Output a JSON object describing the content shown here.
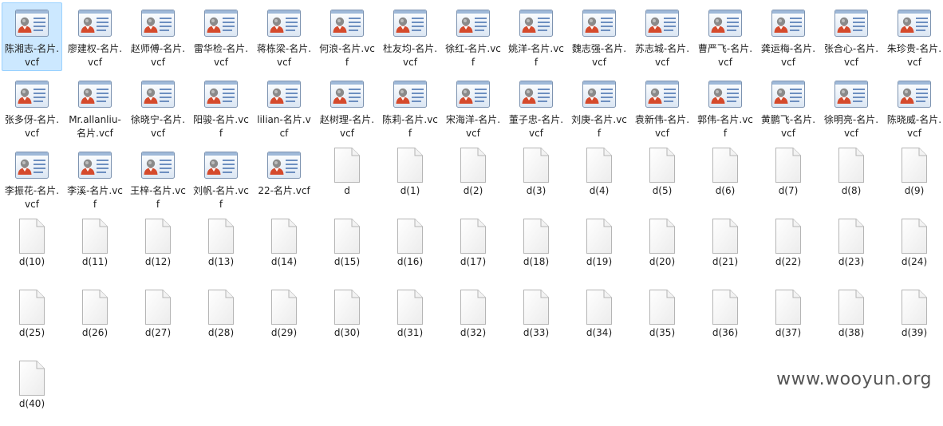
{
  "files": [
    {
      "name": "陈湘志-名片.vcf",
      "type": "vcf",
      "selected": true
    },
    {
      "name": "廖建权-名片.vcf",
      "type": "vcf"
    },
    {
      "name": "赵师傅-名片.vcf",
      "type": "vcf"
    },
    {
      "name": "雷华检-名片.vcf",
      "type": "vcf"
    },
    {
      "name": "蒋栋梁-名片.vcf",
      "type": "vcf"
    },
    {
      "name": "何浪-名片.vcf",
      "type": "vcf"
    },
    {
      "name": "杜友均-名片.vcf",
      "type": "vcf"
    },
    {
      "name": "徐红-名片.vcf",
      "type": "vcf"
    },
    {
      "name": "姚洋-名片.vcf",
      "type": "vcf"
    },
    {
      "name": "魏志强-名片.vcf",
      "type": "vcf"
    },
    {
      "name": "苏志城-名片.vcf",
      "type": "vcf"
    },
    {
      "name": "曹严飞-名片.vcf",
      "type": "vcf"
    },
    {
      "name": "龚运梅-名片.vcf",
      "type": "vcf"
    },
    {
      "name": "张合心-名片.vcf",
      "type": "vcf"
    },
    {
      "name": "朱珍贵-名片.vcf",
      "type": "vcf"
    },
    {
      "name": "张多伢-名片.vcf",
      "type": "vcf"
    },
    {
      "name": "Mr.allanliu-名片.vcf",
      "type": "vcf"
    },
    {
      "name": "徐晓宁-名片.vcf",
      "type": "vcf"
    },
    {
      "name": "阳骏-名片.vcf",
      "type": "vcf"
    },
    {
      "name": "lilian-名片.vcf",
      "type": "vcf"
    },
    {
      "name": "赵树理-名片.vcf",
      "type": "vcf"
    },
    {
      "name": "陈莉-名片.vcf",
      "type": "vcf"
    },
    {
      "name": "宋海洋-名片.vcf",
      "type": "vcf"
    },
    {
      "name": "董子忠-名片.vcf",
      "type": "vcf"
    },
    {
      "name": "刘庚-名片.vcf",
      "type": "vcf"
    },
    {
      "name": "袁新伟-名片.vcf",
      "type": "vcf"
    },
    {
      "name": "郭伟-名片.vcf",
      "type": "vcf"
    },
    {
      "name": "黄鹏飞-名片.vcf",
      "type": "vcf"
    },
    {
      "name": "徐明亮-名片.vcf",
      "type": "vcf"
    },
    {
      "name": "陈晓威-名片.vcf",
      "type": "vcf"
    },
    {
      "name": "李振花-名片.vcf",
      "type": "vcf"
    },
    {
      "name": "李溪-名片.vcf",
      "type": "vcf"
    },
    {
      "name": "王梓-名片.vcf",
      "type": "vcf"
    },
    {
      "name": "刘帆-名片.vcf",
      "type": "vcf"
    },
    {
      "name": "22-名片.vcf",
      "type": "vcf"
    },
    {
      "name": "d",
      "type": "blank"
    },
    {
      "name": "d(1)",
      "type": "blank"
    },
    {
      "name": "d(2)",
      "type": "blank"
    },
    {
      "name": "d(3)",
      "type": "blank"
    },
    {
      "name": "d(4)",
      "type": "blank"
    },
    {
      "name": "d(5)",
      "type": "blank"
    },
    {
      "name": "d(6)",
      "type": "blank"
    },
    {
      "name": "d(7)",
      "type": "blank"
    },
    {
      "name": "d(8)",
      "type": "blank"
    },
    {
      "name": "d(9)",
      "type": "blank"
    },
    {
      "name": "d(10)",
      "type": "blank"
    },
    {
      "name": "d(11)",
      "type": "blank"
    },
    {
      "name": "d(12)",
      "type": "blank"
    },
    {
      "name": "d(13)",
      "type": "blank"
    },
    {
      "name": "d(14)",
      "type": "blank"
    },
    {
      "name": "d(15)",
      "type": "blank"
    },
    {
      "name": "d(16)",
      "type": "blank"
    },
    {
      "name": "d(17)",
      "type": "blank"
    },
    {
      "name": "d(18)",
      "type": "blank"
    },
    {
      "name": "d(19)",
      "type": "blank"
    },
    {
      "name": "d(20)",
      "type": "blank"
    },
    {
      "name": "d(21)",
      "type": "blank"
    },
    {
      "name": "d(22)",
      "type": "blank"
    },
    {
      "name": "d(23)",
      "type": "blank"
    },
    {
      "name": "d(24)",
      "type": "blank"
    },
    {
      "name": "d(25)",
      "type": "blank"
    },
    {
      "name": "d(26)",
      "type": "blank"
    },
    {
      "name": "d(27)",
      "type": "blank"
    },
    {
      "name": "d(28)",
      "type": "blank"
    },
    {
      "name": "d(29)",
      "type": "blank"
    },
    {
      "name": "d(30)",
      "type": "blank"
    },
    {
      "name": "d(31)",
      "type": "blank"
    },
    {
      "name": "d(32)",
      "type": "blank"
    },
    {
      "name": "d(33)",
      "type": "blank"
    },
    {
      "name": "d(34)",
      "type": "blank"
    },
    {
      "name": "d(35)",
      "type": "blank"
    },
    {
      "name": "d(36)",
      "type": "blank"
    },
    {
      "name": "d(37)",
      "type": "blank"
    },
    {
      "name": "d(38)",
      "type": "blank"
    },
    {
      "name": "d(39)",
      "type": "blank"
    },
    {
      "name": "d(40)",
      "type": "blank"
    }
  ],
  "icons": {
    "vcf": "contact-card-icon",
    "blank": "blank-file-icon"
  },
  "watermark": "www.wooyun.org",
  "colors": {
    "selection_bg": "#cce8ff",
    "selection_border": "#99d1ff",
    "text": "#1e1e1e"
  }
}
